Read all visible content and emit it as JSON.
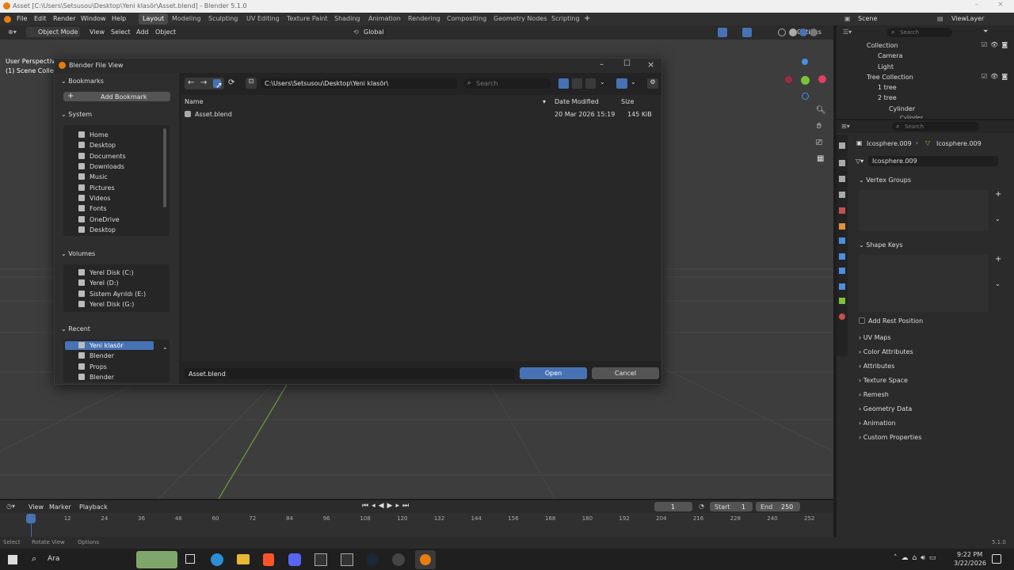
{
  "window": {
    "title": "Asset [C:\\Users\\Setsusou\\Desktop\\Yeni klasör\\Asset.blend] - Blender 5.1.0"
  },
  "menu": {
    "items": [
      "File",
      "Edit",
      "Render",
      "Window",
      "Help"
    ]
  },
  "workspaces": [
    "Layout",
    "Modeling",
    "Sculpting",
    "UV Editing",
    "Texture Paint",
    "Shading",
    "Animation",
    "Rendering",
    "Compositing",
    "Geometry Nodes",
    "Scripting"
  ],
  "topright": {
    "scene": "Scene",
    "viewlayer": "ViewLayer"
  },
  "viewport_header": {
    "mode": "Object Mode",
    "view": "View",
    "select": "Select",
    "add": "Add",
    "object": "Object",
    "orientation": "Global",
    "options": "Options"
  },
  "viewport": {
    "overlay_line1": "User Perspective",
    "overlay_line2": "(1) Scene Collect"
  },
  "outliner": {
    "search_placeholder": "Search",
    "items": [
      {
        "label": "Collection"
      },
      {
        "label": "Camera"
      },
      {
        "label": "Light"
      },
      {
        "label": "Tree Collection"
      },
      {
        "label": "1 tree"
      },
      {
        "label": "2 tree"
      },
      {
        "label": "Cylinder"
      },
      {
        "label": "Cylinder"
      }
    ]
  },
  "properties": {
    "search_placeholder": "Search",
    "breadcrumb_object": "Icosphere.009",
    "breadcrumb_data": "Icosphere.009",
    "mesh_name": "Icosphere.009",
    "vertex_groups": "Vertex Groups",
    "shape_keys": "Shape Keys",
    "add_rest_position": "Add Rest Position",
    "panels": [
      "UV Maps",
      "Color Attributes",
      "Attributes",
      "Texture Space",
      "Remesh",
      "Geometry Data",
      "Animation",
      "Custom Properties"
    ]
  },
  "dialog": {
    "title": "Blender File View",
    "bookmarks": "Bookmarks",
    "add_bookmark": "Add Bookmark",
    "system": "System",
    "system_items": [
      "Home",
      "Desktop",
      "Documents",
      "Downloads",
      "Music",
      "Pictures",
      "Videos",
      "Fonts",
      "OneDrive",
      "Desktop"
    ],
    "volumes": "Volumes",
    "volume_items": [
      "Yerel Disk (C:)",
      "Yerel (D:)",
      "Sistem Ayrıldı (E:)",
      "Yerel Disk (G:)"
    ],
    "recent": "Recent",
    "recent_items": [
      "Yeni klasör",
      "Blender",
      "Props",
      "Blender"
    ],
    "path": "C:\\Users\\Setsusou\\Desktop\\Yeni klasör\\",
    "search_placeholder": "Search",
    "columns": {
      "name": "Name",
      "date": "Date Modified",
      "size": "Size"
    },
    "files": [
      {
        "name": "Asset.blend",
        "date": "20 Mar 2026 15:19",
        "size": "145 KiB"
      }
    ],
    "filename": "Asset.blend",
    "open": "Open",
    "cancel": "Cancel"
  },
  "timeline": {
    "view": "View",
    "marker": "Marker",
    "playback": "Playback",
    "current_frame": "1",
    "start_label": "Start",
    "start": "1",
    "end_label": "End",
    "end": "250",
    "ticks": [
      "1",
      "12",
      "24",
      "36",
      "48",
      "60",
      "72",
      "84",
      "96",
      "108",
      "120",
      "132",
      "144",
      "156",
      "168",
      "180",
      "192",
      "204",
      "216",
      "228",
      "240",
      "252"
    ]
  },
  "statusbar": {
    "select": "Select",
    "rotate": "Rotate View",
    "options": "Options",
    "version": "5.1.0"
  },
  "taskbar": {
    "search": "Ara",
    "time": "9:22 PM",
    "date": "3/22/2026"
  },
  "colors": {
    "accent": "#4772b3",
    "active_workspace": "#4a4a4a",
    "x_axis": "#e0405a",
    "y_axis": "#7cc23b",
    "z_axis": "#4d8ee0"
  }
}
